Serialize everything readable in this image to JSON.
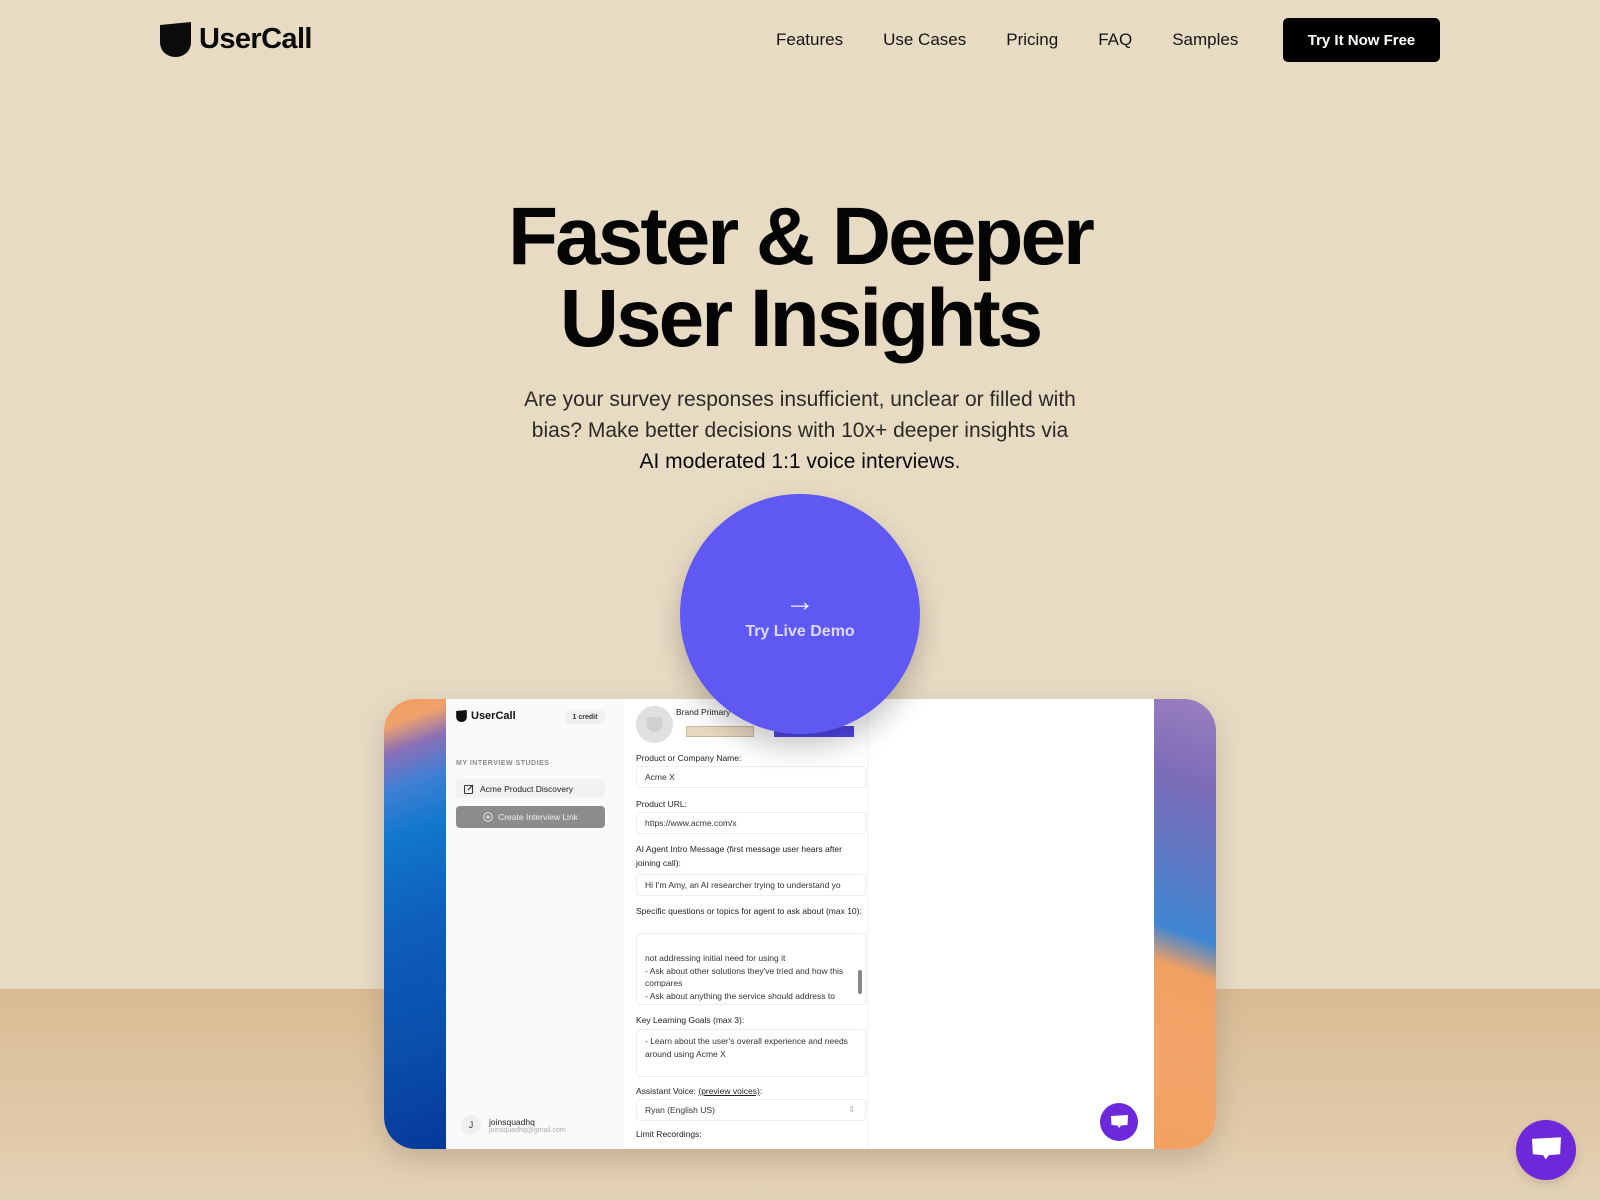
{
  "brand": {
    "name": "UserCall",
    "accent": "#6058f3",
    "chat_color": "#6d28d9"
  },
  "nav": {
    "items": [
      "Features",
      "Use Cases",
      "Pricing",
      "FAQ",
      "Samples"
    ],
    "cta": "Try It Now Free"
  },
  "hero": {
    "headline_line1": "Faster & Deeper",
    "headline_line2": "User Insights",
    "subtitle_plain": "Are your survey responses insufficient, unclear or filled with bias? Make better decisions with 10x+ deeper insights via ",
    "subtitle_strong": "AI moderated 1:1 voice interviews",
    "subtitle_end": ".",
    "demo_icon": "arrow-right-icon",
    "demo_label": "Try Live Demo"
  },
  "app_preview": {
    "sidebar": {
      "logo": "UserCall",
      "credits": "1 credit",
      "section_title": "MY INTERVIEW STUDIES",
      "study": "Acme Product Discovery",
      "create_button": "Create Interview Link",
      "user_initial": "J",
      "user_name": "joinsquadhq",
      "user_email": "joinsquadhq@gmail.com"
    },
    "form": {
      "brand_label": "Brand Primary",
      "brand_colors": [
        "#ead9c1",
        "#4f46e5"
      ],
      "company_label": "Product or Company Name:",
      "company_value": "Acme X",
      "url_label": "Product URL:",
      "url_value": "https://www.acme.com/x",
      "intro_label": "AI Agent Intro Message (first message user hears after joining call):",
      "intro_value": "Hi I'm Amy, an AI researcher trying to understand yo",
      "questions_label": "Specific questions or topics for agent to ask about (max 10):",
      "questions_value": "not addressing initial need for using it\n- Ask about other solutions they've tried and how this compares\n- Ask about anything the service should address to help them with their goals and challenges",
      "goals_label": "Key Learning Goals (max 3):",
      "goals_value": "- Learn about the user's overall experience and needs around using Acme X",
      "voice_label_prefix": "Assistant Voice: ",
      "voice_link": "(preview voices)",
      "voice_label_suffix": ":",
      "voice_value": "Ryan (English US)",
      "limit_label": "Limit Recordings:"
    }
  }
}
